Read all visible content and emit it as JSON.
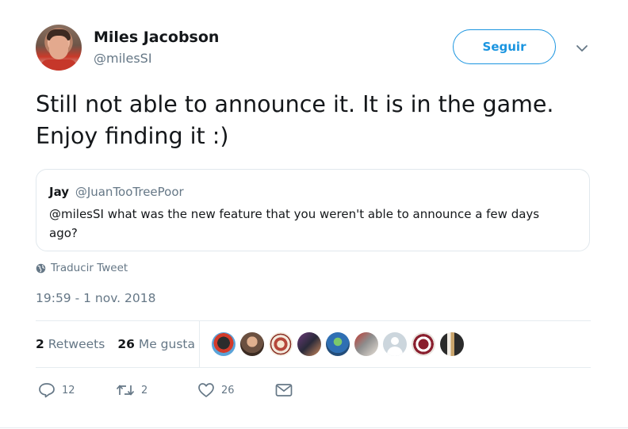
{
  "author": {
    "name": "Miles Jacobson",
    "handle": "@milesSI",
    "follow_label": "Seguir"
  },
  "tweet": {
    "text": "Still not able to announce it. It is in the game. Enjoy finding it :)",
    "translate_label": "Traducir Tweet",
    "timestamp": "19:59 - 1 nov. 2018"
  },
  "quote": {
    "name": "Jay",
    "handle": "@JuanTooTreePoor",
    "text": "@milesSI what was the new feature that you weren't able to announce a few days ago?"
  },
  "stats": {
    "retweets_count": "2",
    "retweets_label": "Retweets",
    "likes_count": "26",
    "likes_label": "Me gusta"
  },
  "actions": {
    "replies": "12",
    "retweets": "2",
    "likes": "26"
  },
  "colors": {
    "accent": "#1b95e0",
    "muted": "#657786",
    "text": "#14171a",
    "border": "#e1e8ed"
  }
}
